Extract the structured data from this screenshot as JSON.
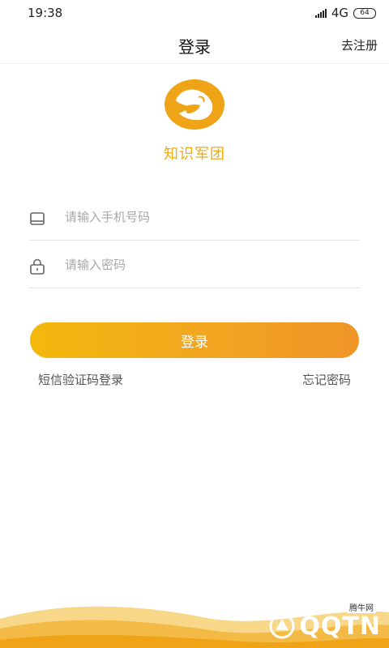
{
  "status": {
    "time": "19:38",
    "network": "4G",
    "battery": "64"
  },
  "nav": {
    "title": "登录",
    "register": "去注册"
  },
  "brand": {
    "name": "知识军团",
    "logo": "flexed-arm-logo",
    "color": "#eeab10"
  },
  "form": {
    "phone_placeholder": "请输入手机号码",
    "password_placeholder": "请输入密码",
    "login_label": "登录"
  },
  "links": {
    "sms_login": "短信验证码登录",
    "forgot": "忘记密码"
  },
  "watermark": {
    "logo": "QQTN",
    "sub": "腾牛网"
  },
  "colors": {
    "accent": "#f2a520",
    "accent_start": "#f3b80c",
    "accent_end": "#ef9527"
  }
}
